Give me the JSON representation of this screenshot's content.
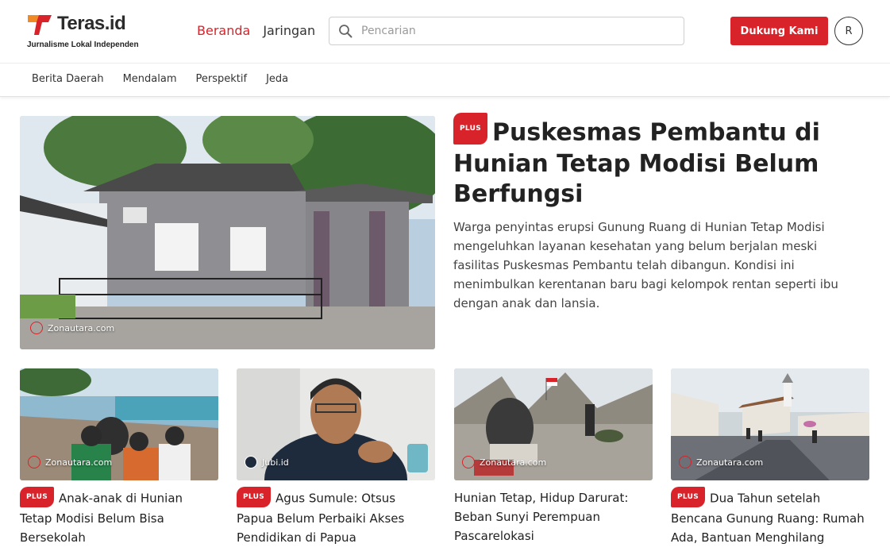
{
  "brand": {
    "name": "Teras.id",
    "tagline": "Jurnalisme Lokal Independen",
    "accent": "#d8232a"
  },
  "nav": {
    "items": [
      {
        "label": "Beranda",
        "active": true
      },
      {
        "label": "Jaringan",
        "active": false
      }
    ]
  },
  "search": {
    "placeholder": "Pencarian",
    "value": "",
    "icon": "search-icon"
  },
  "actions": {
    "support_label": "Dukung Kami",
    "avatar_initial": "R"
  },
  "subnav": {
    "items": [
      {
        "label": "Berita Daerah"
      },
      {
        "label": "Mendalam"
      },
      {
        "label": "Perspektif"
      },
      {
        "label": "Jeda"
      }
    ]
  },
  "featured": {
    "badge": "PLUS",
    "title": "Puskesmas Pembantu di Hunian Tetap Modisi Belum Berfungsi",
    "description": "Warga penyintas erupsi Gunung Ruang di Hunian Tetap Modisi mengeluhkan layanan kesehatan yang belum berjalan meski fasilitas Puskesmas Pembantu telah dibangun. Kondisi ini menimbulkan kerentanan baru bagi kelompok rentan seperti ibu dengan anak dan lansia.",
    "credit": "Zonautara.com"
  },
  "cards": [
    {
      "badge": "PLUS",
      "title": "Anak-anak di Hunian Tetap Modisi Belum Bisa Bersekolah",
      "credit": "Zonautara.com"
    },
    {
      "badge": "PLUS",
      "title": "Agus Sumule: Otsus Papua Belum Perbaiki Akses Pendidikan di Papua",
      "credit": "Jubi.id"
    },
    {
      "badge": "",
      "title": "Hunian Tetap, Hidup Darurat: Beban Sunyi Perempuan Pascarelokasi",
      "credit": "Zonautara.com"
    },
    {
      "badge": "PLUS",
      "title": "Dua Tahun setelah Bencana Gunung Ruang: Rumah Ada, Bantuan Menghilang",
      "credit": "Zonautara.com"
    }
  ]
}
